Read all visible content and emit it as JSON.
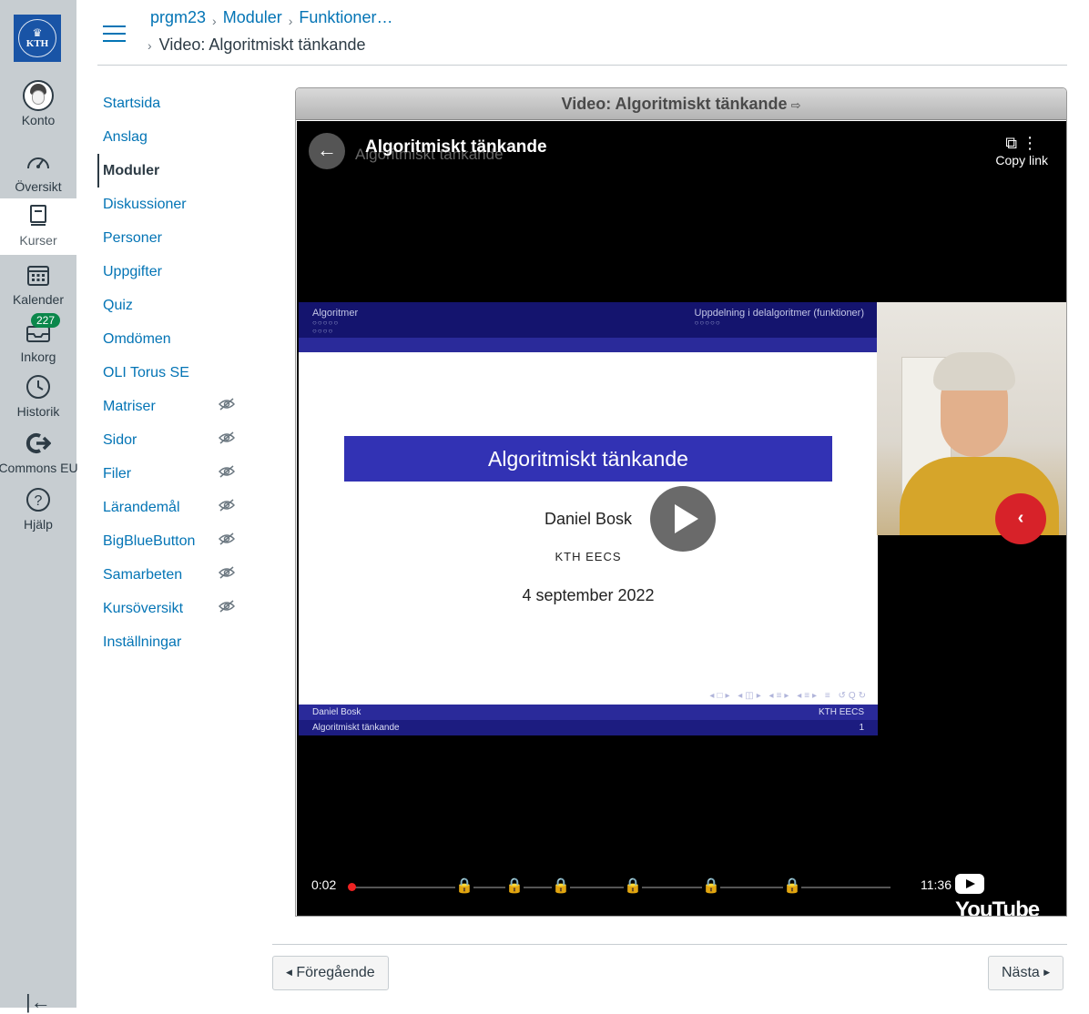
{
  "global_nav": {
    "items": [
      {
        "label": "Konto",
        "icon": "account-avatar-icon"
      },
      {
        "label": "Översikt",
        "icon": "dashboard-icon"
      },
      {
        "label": "Kurser",
        "icon": "courses-icon"
      },
      {
        "label": "Kalender",
        "icon": "calendar-icon"
      },
      {
        "label": "Inkorg",
        "icon": "inbox-icon"
      },
      {
        "label": "Historik",
        "icon": "history-clock-icon"
      },
      {
        "label": "Commons EU",
        "icon": "commons-icon"
      },
      {
        "label": "Hjälp",
        "icon": "help-icon"
      }
    ],
    "inbox_badge": "227",
    "active": "Kurser"
  },
  "breadcrumb": {
    "items": [
      "prgm23",
      "Moduler",
      "Funktioner…"
    ],
    "current": "Video: Algoritmiskt tänkande"
  },
  "course_nav": {
    "items": [
      {
        "label": "Startsida",
        "hidden": false
      },
      {
        "label": "Anslag",
        "hidden": false
      },
      {
        "label": "Moduler",
        "hidden": false,
        "active": true
      },
      {
        "label": "Diskussioner",
        "hidden": false
      },
      {
        "label": "Personer",
        "hidden": false
      },
      {
        "label": "Uppgifter",
        "hidden": false
      },
      {
        "label": "Quiz",
        "hidden": false
      },
      {
        "label": "Omdömen",
        "hidden": false
      },
      {
        "label": "OLI Torus SE",
        "hidden": false
      },
      {
        "label": "Matriser",
        "hidden": true
      },
      {
        "label": "Sidor",
        "hidden": true
      },
      {
        "label": "Filer",
        "hidden": true
      },
      {
        "label": "Lärandemål",
        "hidden": true
      },
      {
        "label": "BigBlueButton",
        "hidden": true
      },
      {
        "label": "Samarbeten",
        "hidden": true
      },
      {
        "label": "Kursöversikt",
        "hidden": true
      },
      {
        "label": "Inställningar",
        "hidden": false
      }
    ]
  },
  "video": {
    "frame_title": "Video: Algoritmiskt tänkande",
    "player_title": "Algoritmiskt tänkande",
    "copy_link": "Copy link",
    "current_time": "0:02",
    "duration": "11:36",
    "progress_fraction": 0.003,
    "brand": "YouTube",
    "slide": {
      "header_left": "Algoritmer",
      "header_right": "Uppdelning i delalgoritmer (funktioner)",
      "title": "Algoritmiskt tänkande",
      "author": "Daniel Bosk",
      "org": "KTH EECS",
      "date": "4 september 2022",
      "footer_left_1": "Daniel Bosk",
      "footer_right_1": "KTH EECS",
      "footer_left_2": "Algoritmiskt tänkande",
      "footer_right_2": "1"
    }
  },
  "footer": {
    "prev": "Föregående",
    "next": "Nästa"
  },
  "colors": {
    "link": "#0374b5",
    "global_nav_bg": "#c7cdd1",
    "badge": "#0b874b",
    "slide_blue": "#3232b4",
    "player_progress": "#e22222"
  }
}
